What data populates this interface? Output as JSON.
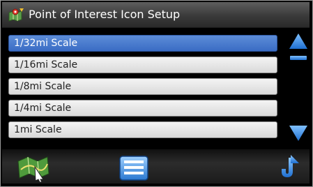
{
  "window": {
    "title": "Point of Interest Icon Setup",
    "title_icon": "poi-app-icon"
  },
  "scale_list": {
    "items": [
      {
        "label": "1/32mi Scale",
        "selected": true
      },
      {
        "label": "1/16mi Scale",
        "selected": false
      },
      {
        "label": "1/8mi Scale",
        "selected": false
      },
      {
        "label": "1/4mi Scale",
        "selected": false
      },
      {
        "label": "1mi Scale",
        "selected": false
      }
    ]
  },
  "scroll": {
    "up_icon": "scroll-up-arrow-icon",
    "down_icon": "scroll-down-arrow-icon"
  },
  "toolbar": {
    "map_icon": "map-icon",
    "list_icon": "list-menu-icon",
    "back_icon": "back-arrow-icon"
  },
  "colors": {
    "selected_item": "#3a6cc4",
    "accent_blue": "#2a7bd6"
  }
}
